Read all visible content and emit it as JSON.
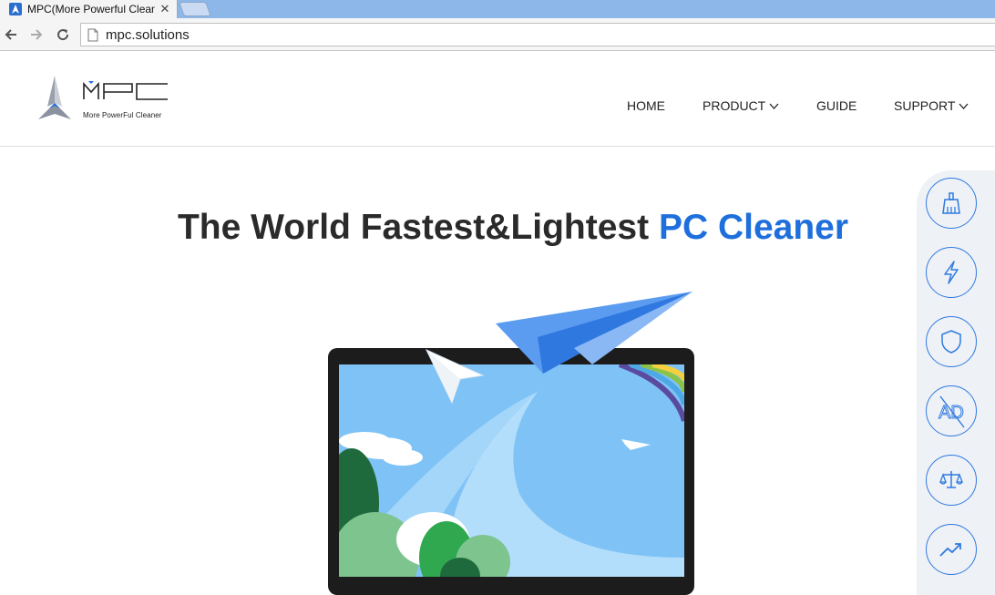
{
  "browser": {
    "tab_title": "MPC(More Powerful Clean",
    "tab_close": "✕",
    "url": "mpc.solutions"
  },
  "site": {
    "logo_sub": "More PowerFul Cleaner",
    "nav": [
      {
        "label": "HOME",
        "has_dropdown": false
      },
      {
        "label": "PRODUCT",
        "has_dropdown": true
      },
      {
        "label": "GUIDE",
        "has_dropdown": false
      },
      {
        "label": "SUPPORT",
        "has_dropdown": true
      }
    ]
  },
  "hero": {
    "title_main": "The World Fastest&Lightest ",
    "title_accent": "PC Cleaner"
  },
  "side_rail": {
    "items": [
      {
        "icon": "broom-clean-icon"
      },
      {
        "icon": "lightning-boost-icon"
      },
      {
        "icon": "shield-protect-icon"
      },
      {
        "icon": "ad-block-icon",
        "text": "AD"
      },
      {
        "icon": "balance-scale-icon"
      },
      {
        "icon": "trend-chart-icon"
      }
    ]
  },
  "colors": {
    "accent": "#1e6fdc",
    "rail_icon": "#2f7ae0",
    "tabstrip": "#8db7e9",
    "screen_sky": "#7fc3f6"
  }
}
